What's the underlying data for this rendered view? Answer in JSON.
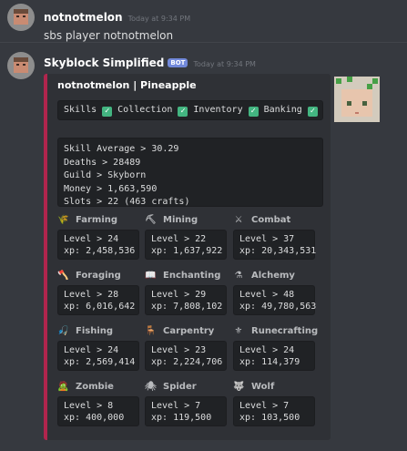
{
  "msg1": {
    "username": "notnotmelon",
    "timestamp": "Today at 9:34 PM",
    "text": "sbs player notnotmelon"
  },
  "msg2": {
    "username": "Skyblock Simplified",
    "bot_tag": "BOT",
    "timestamp": "Today at 9:34 PM"
  },
  "embed": {
    "accent_color": "#b0254d",
    "title": "notnotmelon | Pineapple",
    "checks": [
      {
        "label": "Skills",
        "icon": "✓"
      },
      {
        "label": "Collection",
        "icon": "✓"
      },
      {
        "label": "Inventory",
        "icon": "✓"
      },
      {
        "label": "Banking",
        "icon": "✓"
      }
    ],
    "stats": [
      "Skill Average > 30.29",
      "Deaths > 28489",
      "Guild > Skyborn",
      "Money > 1,663,590",
      "Slots > 22 (463 crafts)"
    ],
    "skills": [
      {
        "name": "Farming",
        "icon": "🌾",
        "level": "Level > 24",
        "xp": "xp: 2,458,536"
      },
      {
        "name": "Mining",
        "icon": "⛏",
        "level": "Level > 22",
        "xp": "xp: 1,637,922"
      },
      {
        "name": "Combat",
        "icon": "⚔",
        "level": "Level > 37",
        "xp": "xp: 20,343,531"
      },
      {
        "name": "Foraging",
        "icon": "🪓",
        "level": "Level > 28",
        "xp": "xp: 6,016,642"
      },
      {
        "name": "Enchanting",
        "icon": "📖",
        "level": "Level > 29",
        "xp": "xp: 7,808,102"
      },
      {
        "name": "Alchemy",
        "icon": "⚗",
        "level": "Level > 48",
        "xp": "xp: 49,780,563"
      },
      {
        "name": "Fishing",
        "icon": "🎣",
        "level": "Level > 24",
        "xp": "xp: 2,569,414"
      },
      {
        "name": "Carpentry",
        "icon": "🪑",
        "level": "Level > 23",
        "xp": "xp: 2,224,706"
      },
      {
        "name": "Runecrafting",
        "icon": "⚜",
        "level": "Level > 24",
        "xp": "xp: 114,379"
      },
      {
        "name": "Zombie",
        "icon": "🧟",
        "level": "Level > 8",
        "xp": "xp: 400,000"
      },
      {
        "name": "Spider",
        "icon": "🕷",
        "level": "Level > 7",
        "xp": "xp: 119,500"
      },
      {
        "name": "Wolf",
        "icon": "🐺",
        "level": "Level > 7",
        "xp": "xp: 103,500"
      }
    ]
  }
}
